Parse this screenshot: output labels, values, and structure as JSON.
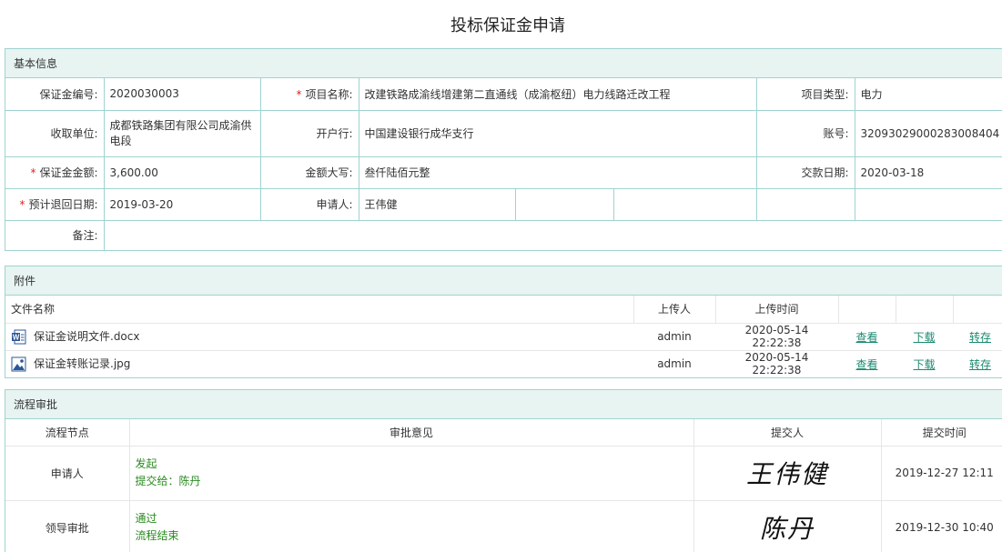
{
  "page": {
    "title": "投标保证金申请"
  },
  "basic": {
    "heading": "基本信息",
    "deposit_no_label": "保证金编号:",
    "deposit_no": "2020030003",
    "project_name_label": "项目名称:",
    "project_name": "改建铁路成渝线增建第二直通线（成渝枢纽）电力线路迁改工程",
    "project_type_label": "项目类型:",
    "project_type": "电力",
    "payee_label": "收取单位:",
    "payee": "成都铁路集团有限公司成渝供电段",
    "bank_label": "开户行:",
    "bank": "中国建设银行成华支行",
    "account_label": "账号:",
    "account": "32093029000283008404",
    "amount_label": "保证金金额:",
    "amount": "3,600.00",
    "amount_upper_label": "金额大写:",
    "amount_upper": "叁仟陆佰元整",
    "pay_date_label": "交款日期:",
    "pay_date": "2020-03-18",
    "refund_date_label": "预计退回日期:",
    "refund_date": "2019-03-20",
    "applicant_label": "申请人:",
    "applicant": "王伟健",
    "remark_label": "备注:",
    "remark": "",
    "required_mark": "*"
  },
  "attachments": {
    "heading": "附件",
    "col_name": "文件名称",
    "col_uploader": "上传人",
    "col_time": "上传时间",
    "rows": [
      {
        "name": "保证金说明文件.docx",
        "icon": "word-doc-icon",
        "uploader": "admin",
        "time": "2020-05-14 22:22:38",
        "view": "查看",
        "download": "下载",
        "save": "转存"
      },
      {
        "name": "保证金转账记录.jpg",
        "icon": "image-file-icon",
        "uploader": "admin",
        "time": "2020-05-14 22:22:38",
        "view": "查看",
        "download": "下载",
        "save": "转存"
      }
    ]
  },
  "workflow": {
    "heading": "流程审批",
    "col_node": "流程节点",
    "col_opinion": "审批意见",
    "col_submitter": "提交人",
    "col_time": "提交时间",
    "rows": [
      {
        "node": "申请人",
        "opinion": "发起",
        "note": "提交给：陈丹",
        "signature": "王伟健",
        "time": "2019-12-27 12:11"
      },
      {
        "node": "领导审批",
        "opinion": "通过",
        "note": "流程结束",
        "signature": "陈丹",
        "time": "2019-12-30 10:40"
      }
    ]
  },
  "colors": {
    "border": "#9fd3d0",
    "header_bg": "#e7f4f2",
    "link": "#1a8a70",
    "approval_text": "#2a8a20",
    "required": "#e02020"
  }
}
